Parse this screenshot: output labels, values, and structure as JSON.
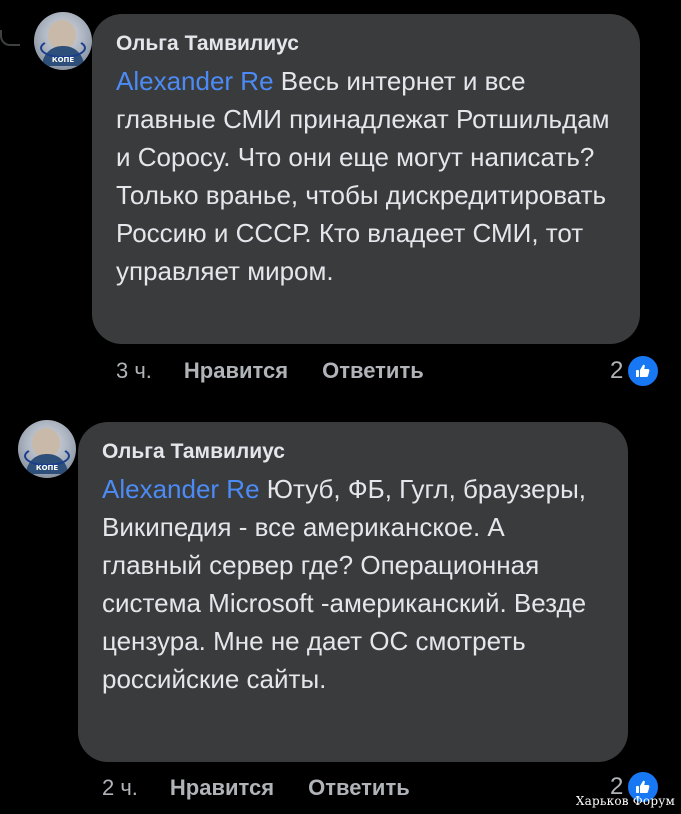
{
  "comments": [
    {
      "author": "Ольга Тамвилиус",
      "mention": "Alexander Re",
      "text": " Весь интернет и все главные СМИ принадлежат Ротшильдам и Соросу. Что они еще могут написать? Только вранье, чтобы дискредитировать Россию и СССР. Кто владеет СМИ, тот управляет миром.",
      "time": "3 ч.",
      "like_label": "Нравится",
      "reply_label": "Ответить",
      "reactions": "2",
      "reaction_icon": "thumbs-up-icon",
      "avatar_logo": "КОПЕ"
    },
    {
      "author": "Ольга Тамвилиус",
      "mention": "Alexander Re",
      "text": " Ютуб, ФБ, Гугл, браузеры, Википедия - все американское. А главный сервер где? Операционная система Microsoft -американский. Везде цензура. Мне не дает ОС смотреть российские сайты.",
      "time": "2 ч.",
      "like_label": "Нравится",
      "reply_label": "Ответить",
      "reactions": "2",
      "reaction_icon": "thumbs-up-icon",
      "avatar_logo": "КОПЕ"
    }
  ],
  "watermark": "Харьков Форум",
  "colors": {
    "background": "#000000",
    "bubble": "#3a3b3c",
    "mention": "#4c8bf5",
    "muted": "#b0b3b8",
    "like_blue": "#1877f2"
  }
}
